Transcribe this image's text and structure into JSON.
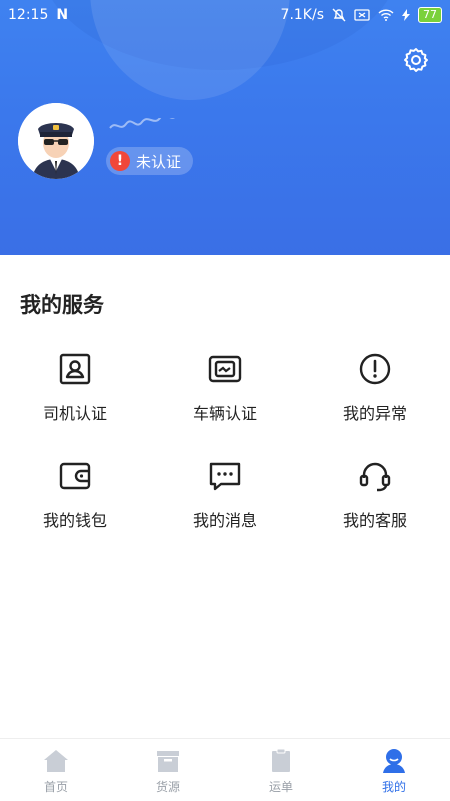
{
  "status_bar": {
    "time": "12:15",
    "network_speed": "7.1K/s",
    "battery": "77",
    "icons": [
      "n-notification-icon",
      "mute-icon",
      "sim-icon",
      "wifi-icon",
      "charging-icon",
      "battery-icon"
    ]
  },
  "header": {
    "settings_icon": "gear-icon",
    "username": "",
    "auth_status": "未认证",
    "accent_color": "#3b78ec",
    "warning_color": "#f0473a"
  },
  "services": {
    "title": "我的服务",
    "items": [
      {
        "label": "司机认证",
        "icon": "driver-id-icon"
      },
      {
        "label": "车辆认证",
        "icon": "vehicle-license-icon"
      },
      {
        "label": "我的异常",
        "icon": "exclamation-circle-icon"
      },
      {
        "label": "我的钱包",
        "icon": "wallet-icon"
      },
      {
        "label": "我的消息",
        "icon": "message-icon"
      },
      {
        "label": "我的客服",
        "icon": "headset-icon"
      }
    ]
  },
  "tabbar": {
    "items": [
      {
        "label": "首页",
        "icon": "home-icon",
        "active": false
      },
      {
        "label": "货源",
        "icon": "cargo-icon",
        "active": false
      },
      {
        "label": "运单",
        "icon": "waybill-icon",
        "active": false
      },
      {
        "label": "我的",
        "icon": "profile-icon",
        "active": true
      }
    ],
    "active_color": "#2f6fe8",
    "inactive_color": "#c9ced6"
  }
}
